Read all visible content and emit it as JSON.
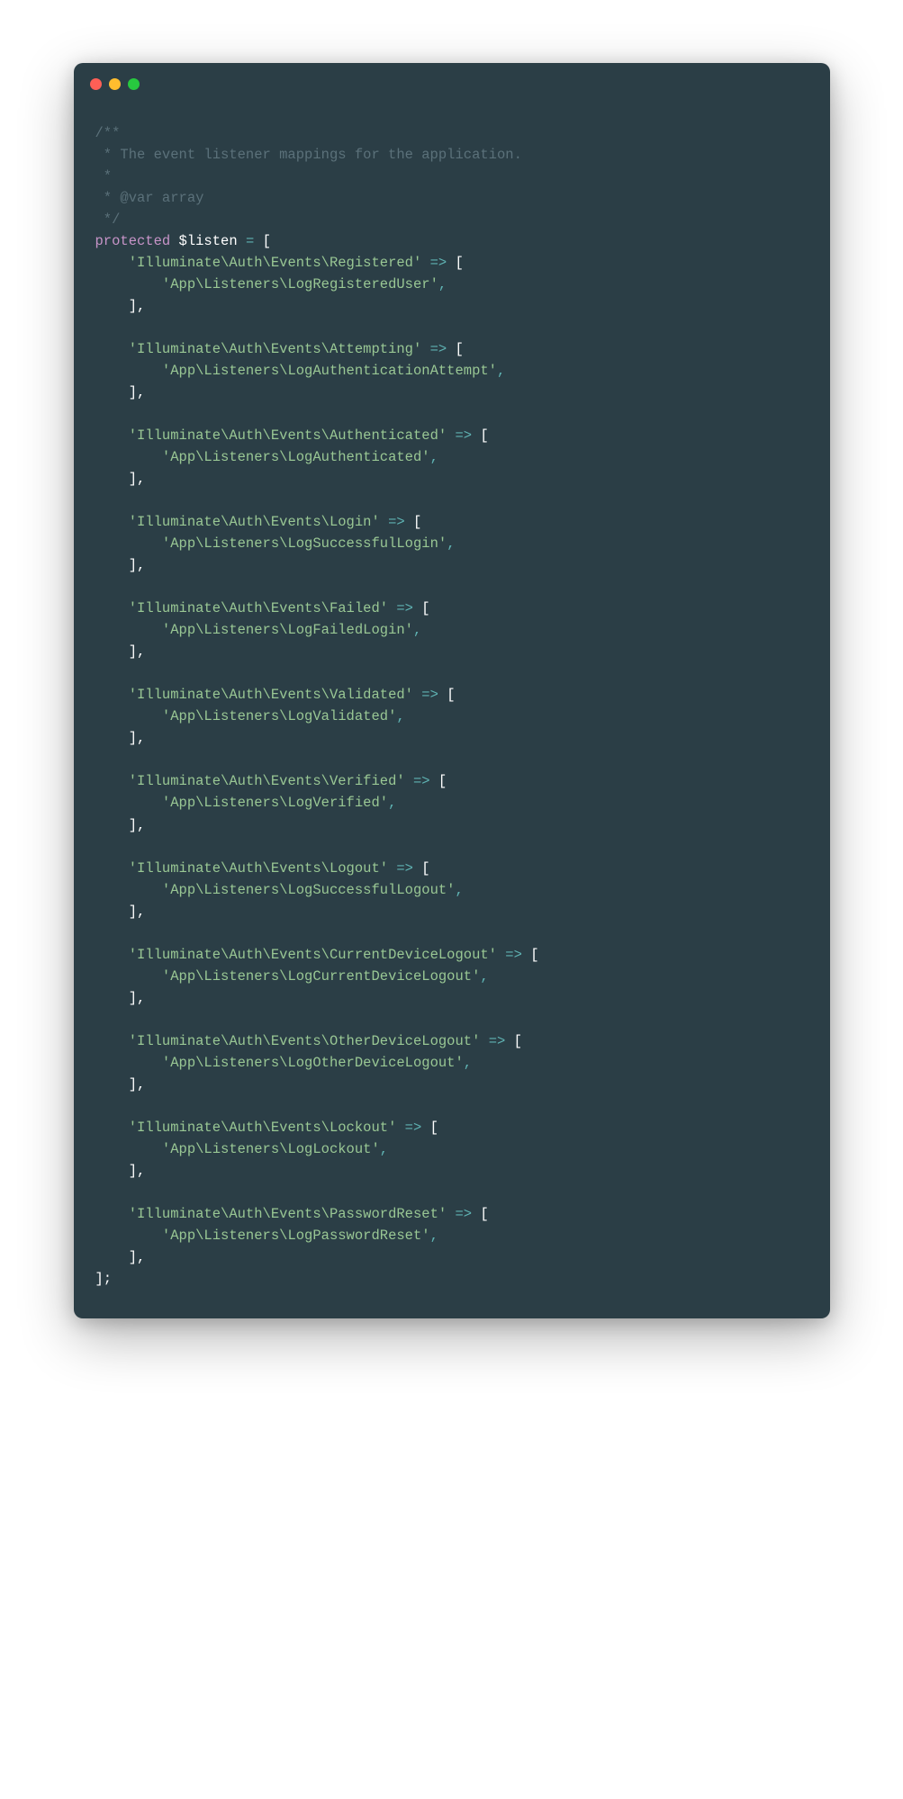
{
  "docblock": {
    "line1": "/**",
    "line2": " * The event listener mappings for the application.",
    "line3": " *",
    "line4": " * @var array",
    "line5": " */"
  },
  "decl": {
    "keyword": "protected",
    "var": "$listen",
    "eq": " = ",
    "open": "["
  },
  "entries": [
    {
      "event": "'Illuminate\\Auth\\Events\\Registered'",
      "listener": "'App\\Listeners\\LogRegisteredUser'"
    },
    {
      "event": "'Illuminate\\Auth\\Events\\Attempting'",
      "listener": "'App\\Listeners\\LogAuthenticationAttempt'"
    },
    {
      "event": "'Illuminate\\Auth\\Events\\Authenticated'",
      "listener": "'App\\Listeners\\LogAuthenticated'"
    },
    {
      "event": "'Illuminate\\Auth\\Events\\Login'",
      "listener": "'App\\Listeners\\LogSuccessfulLogin'"
    },
    {
      "event": "'Illuminate\\Auth\\Events\\Failed'",
      "listener": "'App\\Listeners\\LogFailedLogin'"
    },
    {
      "event": "'Illuminate\\Auth\\Events\\Validated'",
      "listener": "'App\\Listeners\\LogValidated'"
    },
    {
      "event": "'Illuminate\\Auth\\Events\\Verified'",
      "listener": "'App\\Listeners\\LogVerified'"
    },
    {
      "event": "'Illuminate\\Auth\\Events\\Logout'",
      "listener": "'App\\Listeners\\LogSuccessfulLogout'"
    },
    {
      "event": "'Illuminate\\Auth\\Events\\CurrentDeviceLogout'",
      "listener": "'App\\Listeners\\LogCurrentDeviceLogout'"
    },
    {
      "event": "'Illuminate\\Auth\\Events\\OtherDeviceLogout'",
      "listener": "'App\\Listeners\\LogOtherDeviceLogout'"
    },
    {
      "event": "'Illuminate\\Auth\\Events\\Lockout'",
      "listener": "'App\\Listeners\\LogLockout'"
    },
    {
      "event": "'Illuminate\\Auth\\Events\\PasswordReset'",
      "listener": "'App\\Listeners\\LogPasswordReset'"
    }
  ],
  "tokens": {
    "arrow": " => ",
    "openBracket": "[",
    "closeBracketComma": "],",
    "closeBracketSemi": "];",
    "comma": ","
  },
  "indent": {
    "l1": "    ",
    "l2": "        "
  }
}
